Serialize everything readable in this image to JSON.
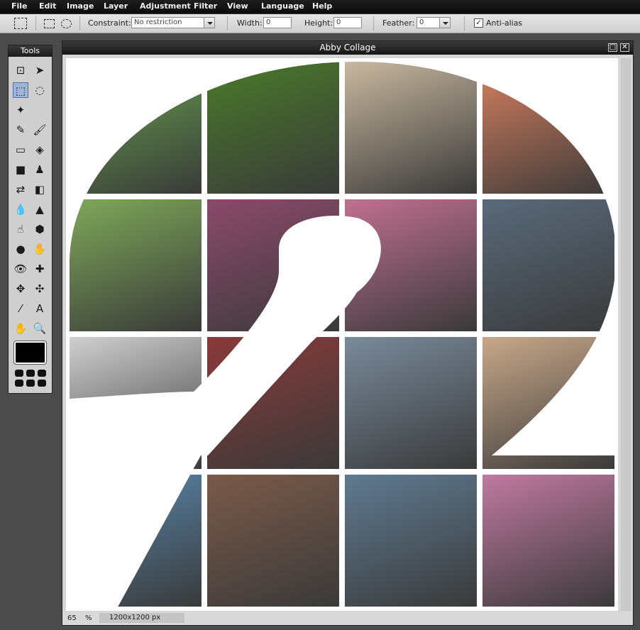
{
  "menu": [
    "File",
    "Edit",
    "Image",
    "Layer",
    "Adjustment",
    "Filter",
    "View",
    "Language",
    "Help"
  ],
  "options": {
    "constraint_label": "Constraint:",
    "constraint_value": "No restriction",
    "width_label": "Width:",
    "width_value": "0",
    "height_label": "Height:",
    "height_value": "0",
    "feather_label": "Feather:",
    "feather_value": "0",
    "antialias_label": "Anti-alias",
    "antialias_checked": true
  },
  "tools": {
    "title": "Tools",
    "items": [
      {
        "name": "crop-icon",
        "glyph": "⊡"
      },
      {
        "name": "move-icon",
        "glyph": "➤"
      },
      {
        "name": "marquee-icon",
        "glyph": "⬚"
      },
      {
        "name": "lasso-icon",
        "glyph": "◌"
      },
      {
        "name": "magic-wand-icon",
        "glyph": "✦"
      },
      {
        "name": "pencil-icon",
        "glyph": "✎"
      },
      {
        "name": "brush-icon",
        "glyph": "🖌"
      },
      {
        "name": "eraser-icon",
        "glyph": "▭"
      },
      {
        "name": "bucket-icon",
        "glyph": "◈"
      },
      {
        "name": "gradient-icon",
        "glyph": "■"
      },
      {
        "name": "clone-stamp-icon",
        "glyph": "♟"
      },
      {
        "name": "color-replace-icon",
        "glyph": "⇄"
      },
      {
        "name": "shapes-icon",
        "glyph": "◧"
      },
      {
        "name": "blur-icon",
        "glyph": "💧"
      },
      {
        "name": "sharpen-icon",
        "glyph": "▲"
      },
      {
        "name": "smudge-icon",
        "glyph": "☝"
      },
      {
        "name": "sponge-icon",
        "glyph": "⬢"
      },
      {
        "name": "dodge-icon",
        "glyph": "●"
      },
      {
        "name": "burn-icon",
        "glyph": "✋"
      },
      {
        "name": "red-eye-icon",
        "glyph": "👁"
      },
      {
        "name": "spot-heal-icon",
        "glyph": "✚"
      },
      {
        "name": "bloat-icon",
        "glyph": "✥"
      },
      {
        "name": "pinch-icon",
        "glyph": "✣"
      },
      {
        "name": "color-picker-icon",
        "glyph": "⁄"
      },
      {
        "name": "type-icon",
        "glyph": "A"
      },
      {
        "name": "hand-icon",
        "glyph": "✋"
      },
      {
        "name": "zoom-icon",
        "glyph": "🔍"
      }
    ]
  },
  "document": {
    "title": "Abby Collage",
    "zoom": "65",
    "zoom_unit": "%",
    "dimensions": "1200x1200 px"
  },
  "colors": {
    "foreground": "#000000",
    "selection": "#9fb4d8"
  }
}
